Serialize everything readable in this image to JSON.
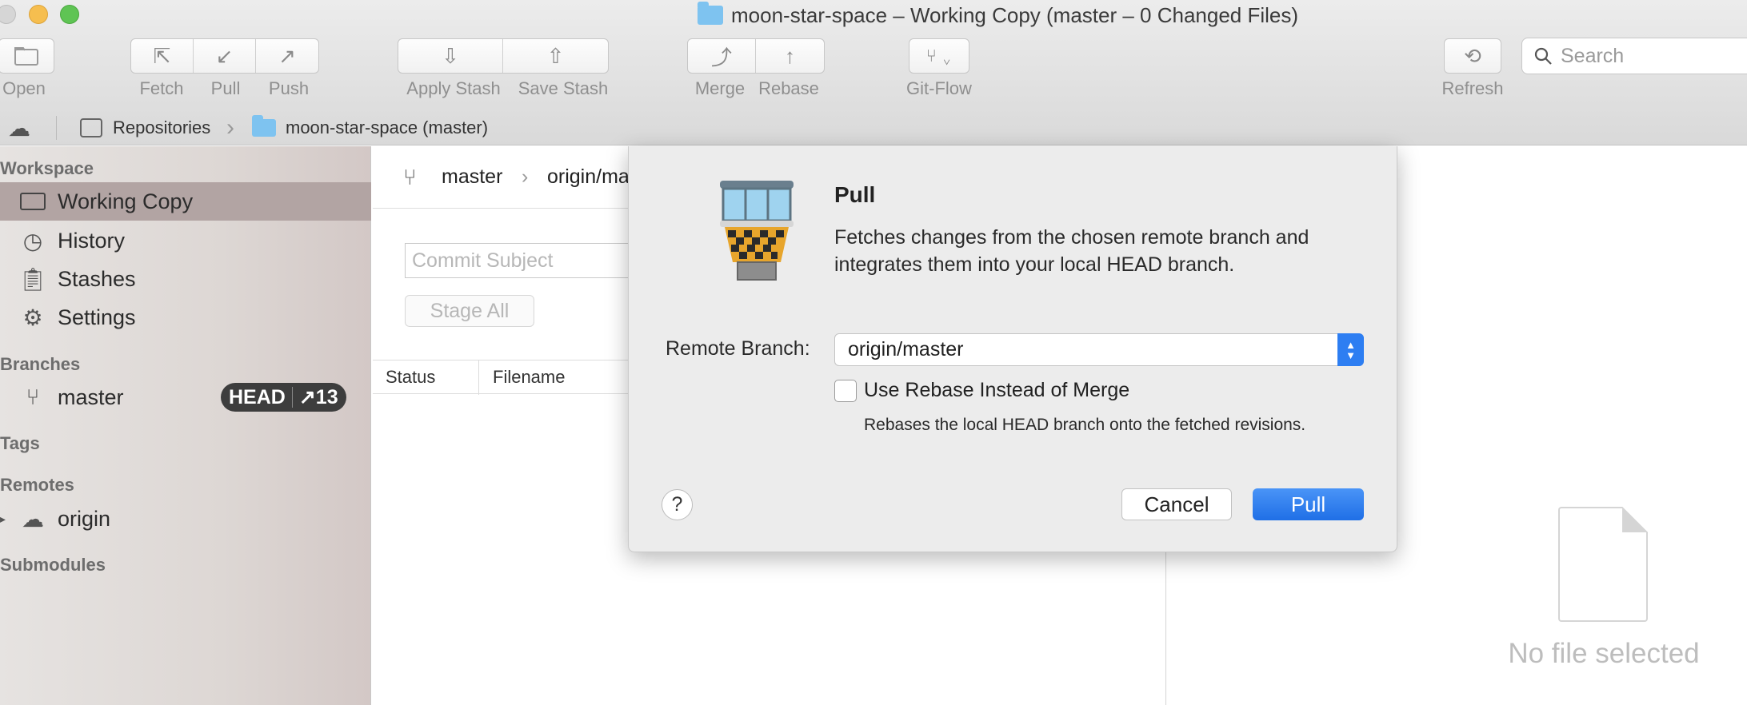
{
  "window": {
    "title": "moon-star-space – Working Copy (master – 0 Changed Files)"
  },
  "toolbar": {
    "open": "Open",
    "fetch": "Fetch",
    "pull": "Pull",
    "push": "Push",
    "apply_stash": "Apply Stash",
    "save_stash": "Save Stash",
    "merge": "Merge",
    "rebase": "Rebase",
    "git_flow": "Git-Flow",
    "refresh": "Refresh",
    "search_placeholder": "Search"
  },
  "pathbar": {
    "repositories": "Repositories",
    "repo": "moon-star-space (master)"
  },
  "sidebar": {
    "workspace_header": "Workspace",
    "working_copy": "Working Copy",
    "history": "History",
    "stashes": "Stashes",
    "settings": "Settings",
    "branches_header": "Branches",
    "branch_master": "master",
    "head_badge": "HEAD",
    "ahead_count": "↗13",
    "tags_header": "Tags",
    "remotes_header": "Remotes",
    "remote_origin": "origin",
    "submodules_header": "Submodules"
  },
  "main": {
    "branch_local": "master",
    "branch_remote": "origin/ma",
    "commit_placeholder": "Commit Subject",
    "stage_all": "Stage All",
    "col_status": "Status",
    "col_filename": "Filename",
    "no_file": "No file selected"
  },
  "dialog": {
    "title": "Pull",
    "description": "Fetches changes from the chosen remote branch and integrates them into your local HEAD branch.",
    "remote_branch_label": "Remote Branch:",
    "remote_branch_value": "origin/master",
    "rebase_label": "Use Rebase Instead of Merge",
    "rebase_checked": false,
    "rebase_hint": "Rebases the local HEAD branch onto the fetched revisions.",
    "help": "?",
    "cancel": "Cancel",
    "pull": "Pull",
    "accent_color": "#2d7ef2"
  }
}
